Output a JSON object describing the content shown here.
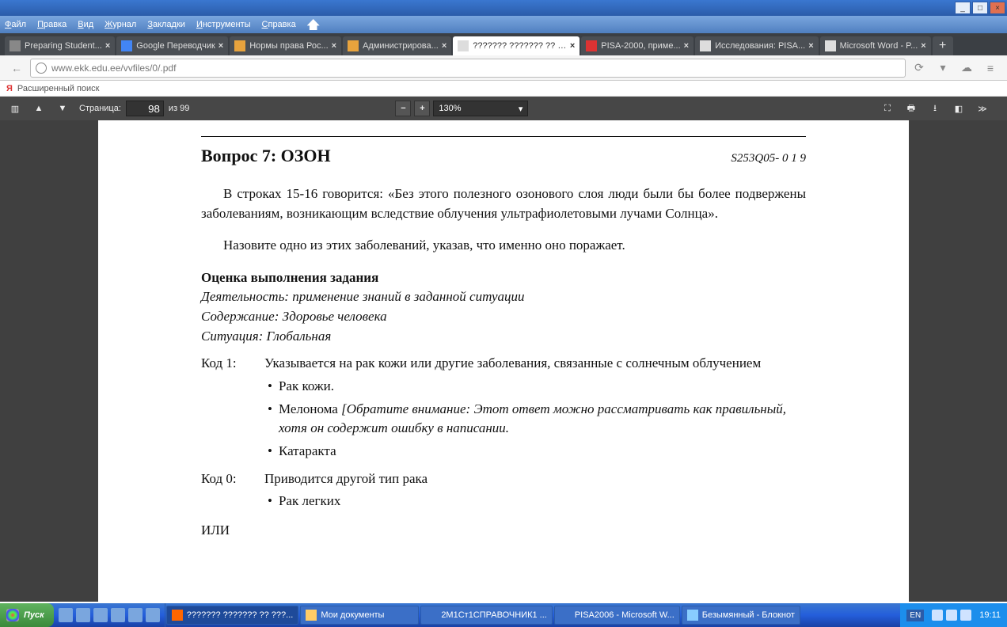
{
  "menu": {
    "file": "Файл",
    "edit": "Правка",
    "view": "Вид",
    "journal": "Журнал",
    "bookmarks": "Закладки",
    "tools": "Инструменты",
    "help": "Справка"
  },
  "tabs": [
    {
      "label": "Preparing Student..."
    },
    {
      "label": "Google Переводчик"
    },
    {
      "label": "Нормы права Рос..."
    },
    {
      "label": "Администрирова..."
    },
    {
      "label": "??????? ??????? ?? ????..."
    },
    {
      "label": "PISA-2000, приме..."
    },
    {
      "label": "Исследования: PISA..."
    },
    {
      "label": "Microsoft Word - P..."
    }
  ],
  "active_tab": 4,
  "url": "www.ekk.edu.ee/vvfiles/0/.pdf",
  "bookmark": {
    "y": "Я",
    "label": "Расширенный поиск"
  },
  "pdf": {
    "page_label": "Страница:",
    "page": "98",
    "of": "из 99",
    "zoom": "130%"
  },
  "doc": {
    "q_title": "Вопрос 7: ОЗОН",
    "q_code": "S253Q05- 0  1  9",
    "p1": "В строках 15-16 говорится: «Без этого полезного озонового слоя люди были бы более подвержены заболеваниям, возникающим вследствие облучения ультрафиолетовыми лучами Солнца».",
    "p2": "Назовите одно из этих заболеваний, указав, что именно оно поражает.",
    "sect": "Оценка выполнения задания",
    "act": "Деятельность: применение знаний в заданной ситуации",
    "cont": "Содержание: Здоровье человека",
    "sit": "Ситуация: Глобальная",
    "k1": "Код 1:",
    "k1t": "Указывается на рак кожи или другие заболевания, связанные с солнечным облучением",
    "k1b1": "Рак кожи.",
    "k1b2": "Мелонома  [Обратите внимание: Этот ответ можно рассматривать как правильный, хотя он содержит ошибку в написании.",
    "k1b3": "Катаракта",
    "k0": "Код 0:",
    "k0t": "Приводится другой тип рака",
    "k0b1": "Рак легких",
    "or": "ИЛИ"
  },
  "taskbar": {
    "start": "Пуск",
    "tasks": [
      {
        "label": "??????? ??????? ?? ???..."
      },
      {
        "label": "Мои документы"
      },
      {
        "label": "2М1Ст1СПРАВОЧНИК1 ..."
      },
      {
        "label": "PISA2006 - Microsoft W..."
      },
      {
        "label": "Безымянный - Блокнот"
      }
    ],
    "lang": "EN",
    "time": "19:11"
  }
}
